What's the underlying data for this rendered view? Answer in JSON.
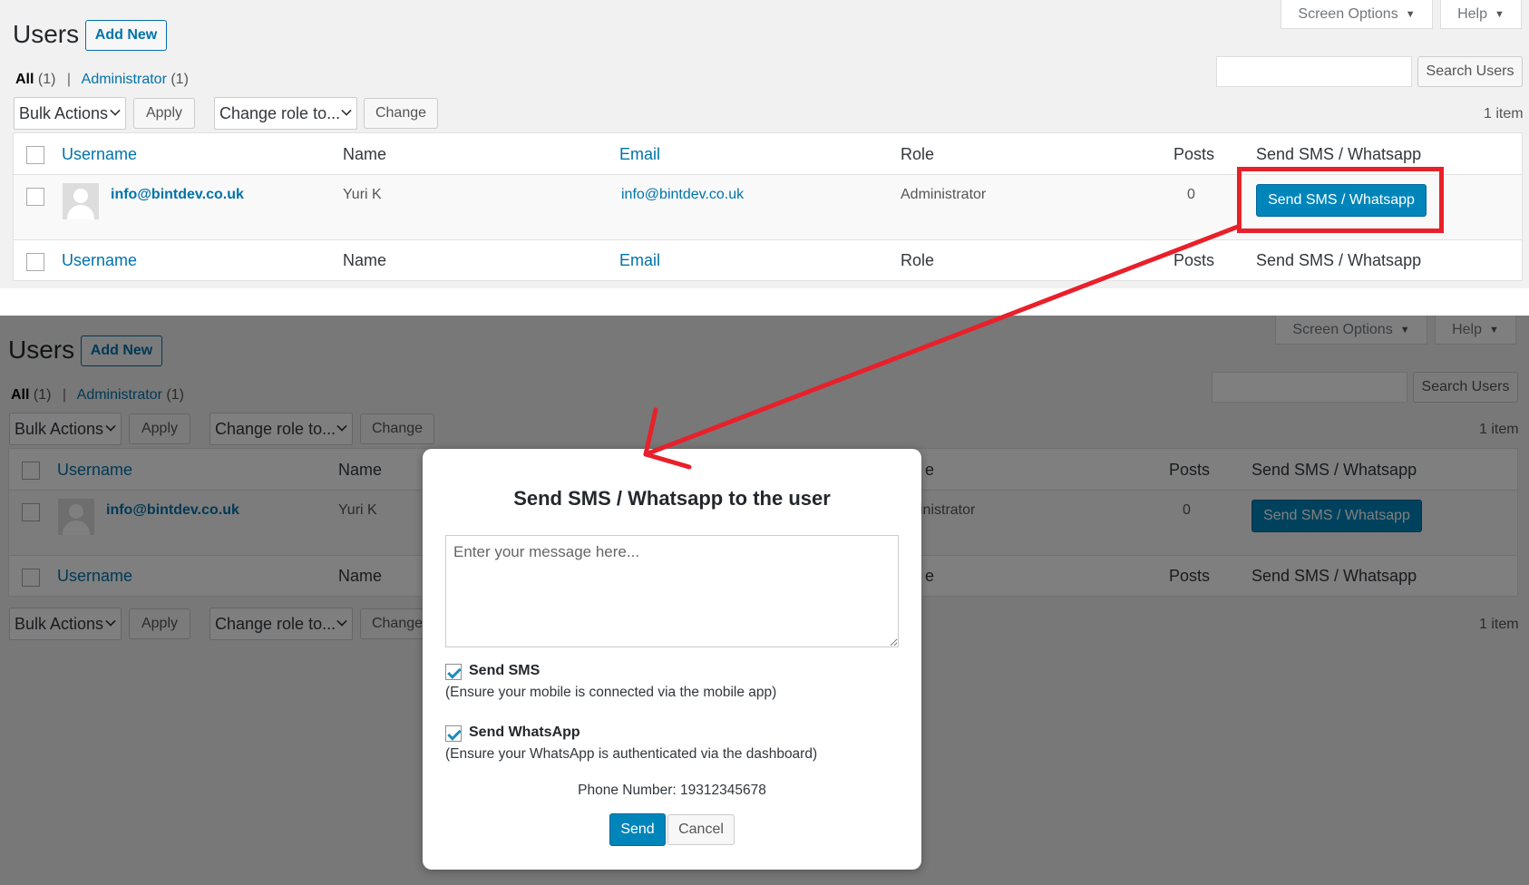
{
  "header": {
    "title": "Users",
    "add_new": "Add New",
    "screen_options": "Screen Options",
    "help": "Help"
  },
  "filters": {
    "all_label": "All",
    "all_count": "(1)",
    "admin_label": "Administrator",
    "admin_count": "(1)"
  },
  "toolbar": {
    "bulk_actions": "Bulk Actions",
    "apply": "Apply",
    "change_role": "Change role to...",
    "change": "Change",
    "search_users": "Search Users",
    "item_count": "1 item"
  },
  "table": {
    "columns": {
      "username": "Username",
      "name": "Name",
      "email": "Email",
      "role": "Role",
      "posts": "Posts",
      "sms": "Send SMS / Whatsapp"
    },
    "rows": [
      {
        "username": "info@bintdev.co.uk",
        "name": "Yuri K",
        "email": "info@bintdev.co.uk",
        "role": "Administrator",
        "posts": "0",
        "action": "Send SMS / Whatsapp"
      }
    ],
    "role_partial": "e",
    "role_partial_admin": "inistrator"
  },
  "modal": {
    "title": "Send SMS / Whatsapp to the user",
    "message_placeholder": "Enter your message here...",
    "send_sms_label": "Send SMS",
    "send_sms_checked": true,
    "send_sms_note": "(Ensure your mobile is connected via the mobile app)",
    "send_whatsapp_label": "Send WhatsApp",
    "send_whatsapp_checked": true,
    "send_whatsapp_note": "(Ensure your WhatsApp is authenticated via the dashboard)",
    "phone_label": "Phone Number: 19312345678",
    "send_button": "Send",
    "cancel_button": "Cancel"
  },
  "colors": {
    "annotation_red": "#e8202a",
    "primary_blue": "#0085ba",
    "link_blue": "#0073aa"
  }
}
